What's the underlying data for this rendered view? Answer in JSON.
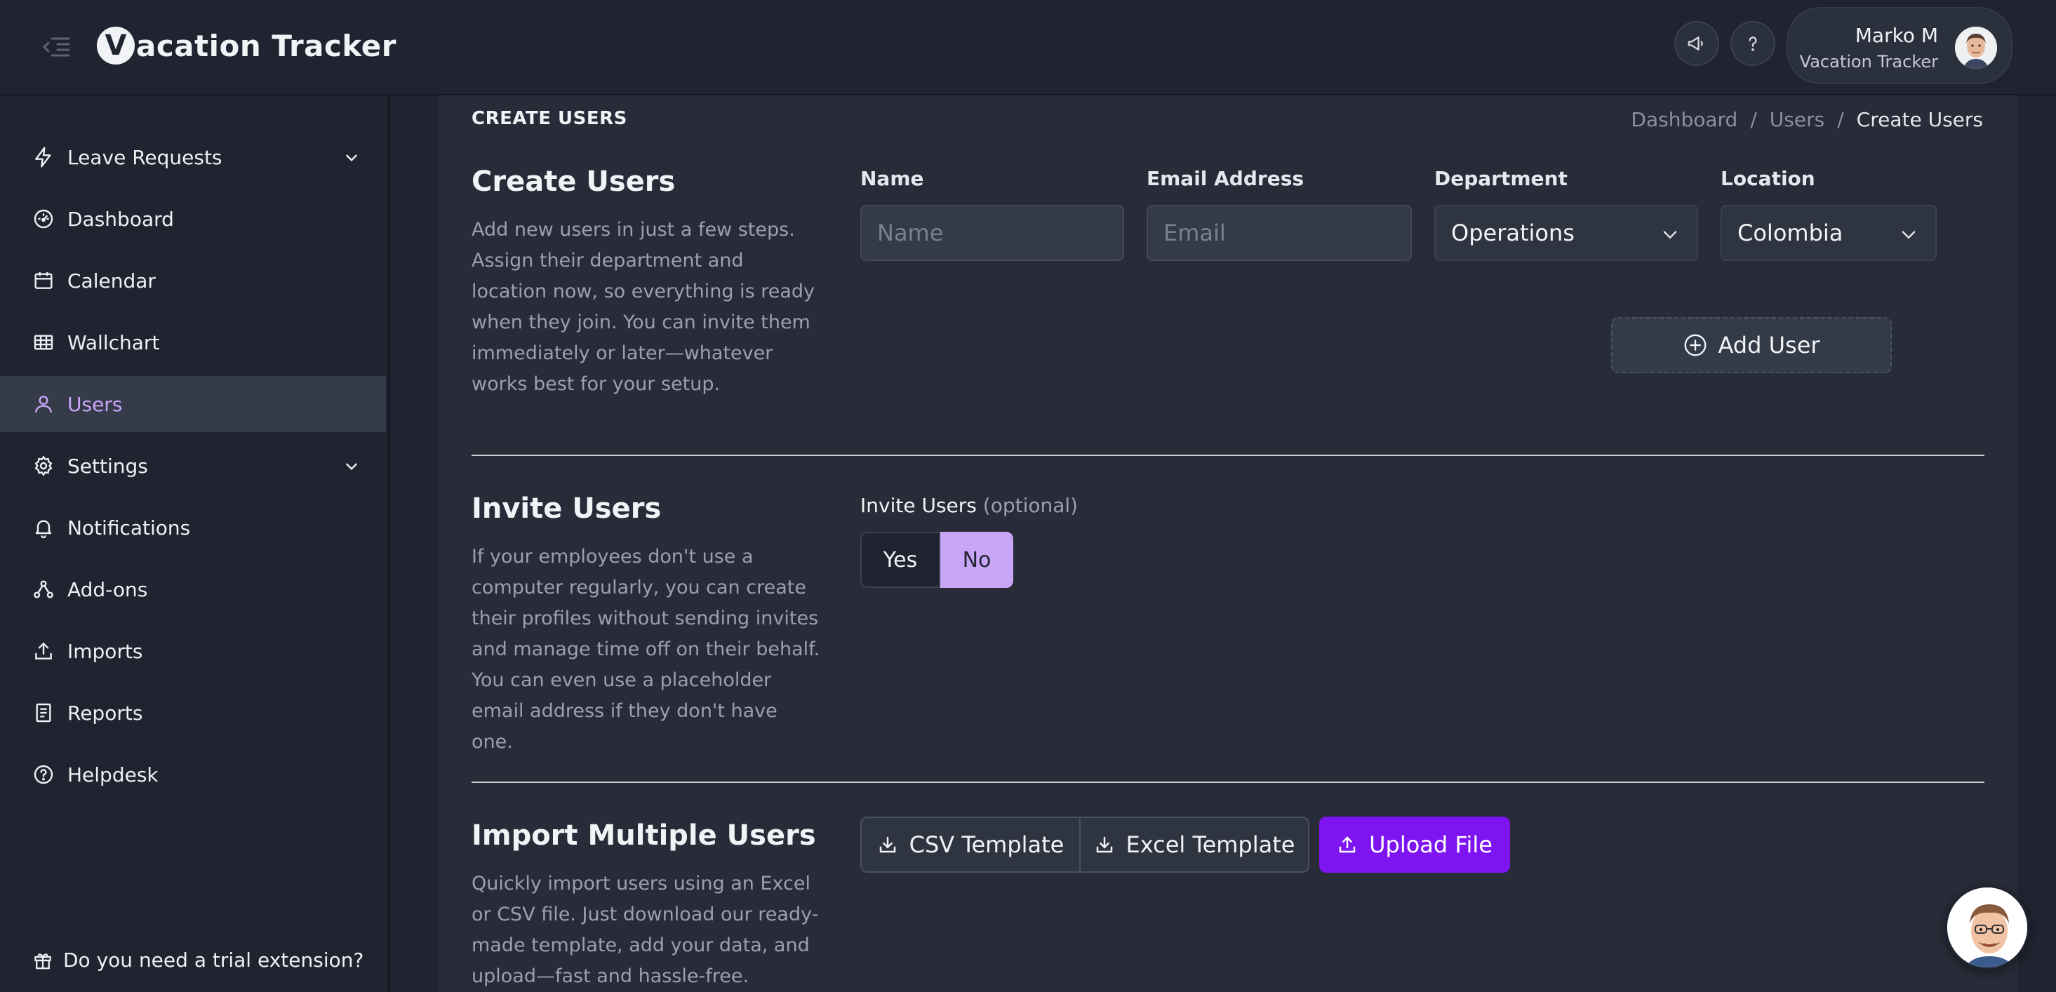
{
  "app": {
    "logo_letter": "V",
    "logo_text": "acation Tracker"
  },
  "header": {
    "user_name": "Marko M",
    "user_company": "Vacation Tracker"
  },
  "sidebar": {
    "items": [
      {
        "label": "Leave Requests",
        "icon": "lightning-icon",
        "expandable": true
      },
      {
        "label": "Dashboard",
        "icon": "gauge-icon"
      },
      {
        "label": "Calendar",
        "icon": "calendar-icon"
      },
      {
        "label": "Wallchart",
        "icon": "grid-icon"
      },
      {
        "label": "Users",
        "icon": "user-icon",
        "active": true
      },
      {
        "label": "Settings",
        "icon": "gear-icon",
        "expandable": true
      },
      {
        "label": "Notifications",
        "icon": "bell-icon"
      },
      {
        "label": "Add-ons",
        "icon": "network-icon"
      },
      {
        "label": "Imports",
        "icon": "upload-icon"
      },
      {
        "label": "Reports",
        "icon": "report-icon"
      },
      {
        "label": "Helpdesk",
        "icon": "help-circle-icon"
      }
    ],
    "trial": "Do you need a trial extension?"
  },
  "page": {
    "heading": "CREATE USERS",
    "breadcrumb": [
      "Dashboard",
      "/",
      "Users",
      "/",
      "Create Users"
    ]
  },
  "create": {
    "title": "Create Users",
    "description": "Add new users in just a few steps. Assign their department and location now, so everything is ready when they join. You can invite them immediately or later—whatever works best for your setup.",
    "name_label": "Name",
    "name_placeholder": "Name",
    "email_label": "Email Address",
    "email_placeholder": "Email",
    "department_label": "Department",
    "department_value": "Operations",
    "location_label": "Location",
    "location_value": "Colombia",
    "add_user_label": "Add User"
  },
  "invite": {
    "title": "Invite Users",
    "description": "If your employees don't use a computer regularly, you can create their profiles without sending invites and manage time off on their behalf. You can even use a placeholder email address if they don't have one.",
    "label": "Invite Users",
    "optional": "(optional)",
    "yes": "Yes",
    "no": "No",
    "selected": "No"
  },
  "import": {
    "title": "Import Multiple Users",
    "description": "Quickly import users using an Excel or CSV file. Just download our ready-made template, add your data, and upload—fast and hassle-free.",
    "csv_label": "CSV Template",
    "excel_label": "Excel Template",
    "upload_label": "Upload File"
  },
  "colors": {
    "accent": "#c9a5f7",
    "primary": "#7e14f2",
    "background": "#1f2430",
    "card": "#272c38"
  }
}
